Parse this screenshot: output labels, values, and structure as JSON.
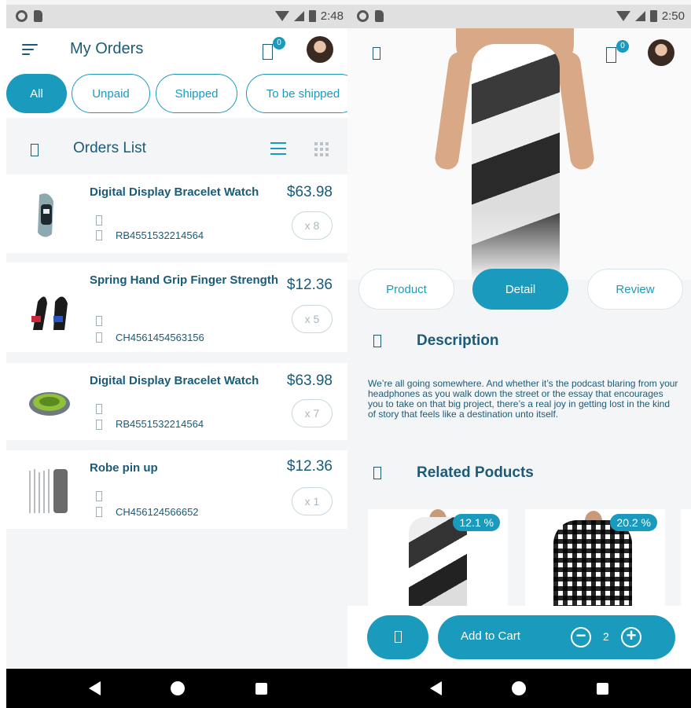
{
  "colors": {
    "accent": "#1a9bbd",
    "text": "#1a5b78",
    "background": "#f3f5f7"
  },
  "left": {
    "status": {
      "time": "2:48"
    },
    "header": {
      "title": "My Orders",
      "cart_badge": "0",
      "menu_icon": "hamburger-icon",
      "cart_icon": "cart-icon"
    },
    "filters": [
      {
        "label": "All",
        "active": true
      },
      {
        "label": "Unpaid",
        "active": false
      },
      {
        "label": "Shipped",
        "active": false
      },
      {
        "label": "To be shipped",
        "active": false
      }
    ],
    "section": {
      "title": "Orders List"
    },
    "orders": [
      {
        "name": "Digital Display Bracelet Watch",
        "price": "$63.98",
        "qty": "x 8",
        "code": "RB4551532214564",
        "image": "bracelet-watch"
      },
      {
        "name": "Spring Hand Grip Finger Strength",
        "price": "$12.36",
        "qty": "x 5",
        "code": "CH4561454563156",
        "image": "hand-grip"
      },
      {
        "name": "Digital Display Bracelet Watch",
        "price": "$63.98",
        "qty": "x 7",
        "code": "RB4551532214564",
        "image": "collapsible-bowl"
      },
      {
        "name": "Robe pin up",
        "price": "$12.36",
        "qty": "x 1",
        "code": "CH456124566652",
        "image": "metal-straws"
      }
    ]
  },
  "right": {
    "status": {
      "time": "2:50"
    },
    "header": {
      "cart_badge": "0"
    },
    "tabs": [
      {
        "label": "Product",
        "active": false
      },
      {
        "label": "Detail",
        "active": true
      },
      {
        "label": "Review",
        "active": false
      }
    ],
    "description": {
      "title": "Description",
      "text": "We’re all going somewhere. And whether it’s the podcast blaring from your headphones as you walk down the street or the essay that encourages you to take on that big project, there’s a real joy in getting lost in the kind of story that feels like a destination unto itself."
    },
    "related": {
      "title": "Related Poducts",
      "items": [
        {
          "discount": "12.1 %"
        },
        {
          "discount": "20.2 %"
        }
      ]
    },
    "bottom": {
      "add_to_cart": "Add to Cart",
      "quantity": "2",
      "minus": "−",
      "plus": "+"
    }
  }
}
